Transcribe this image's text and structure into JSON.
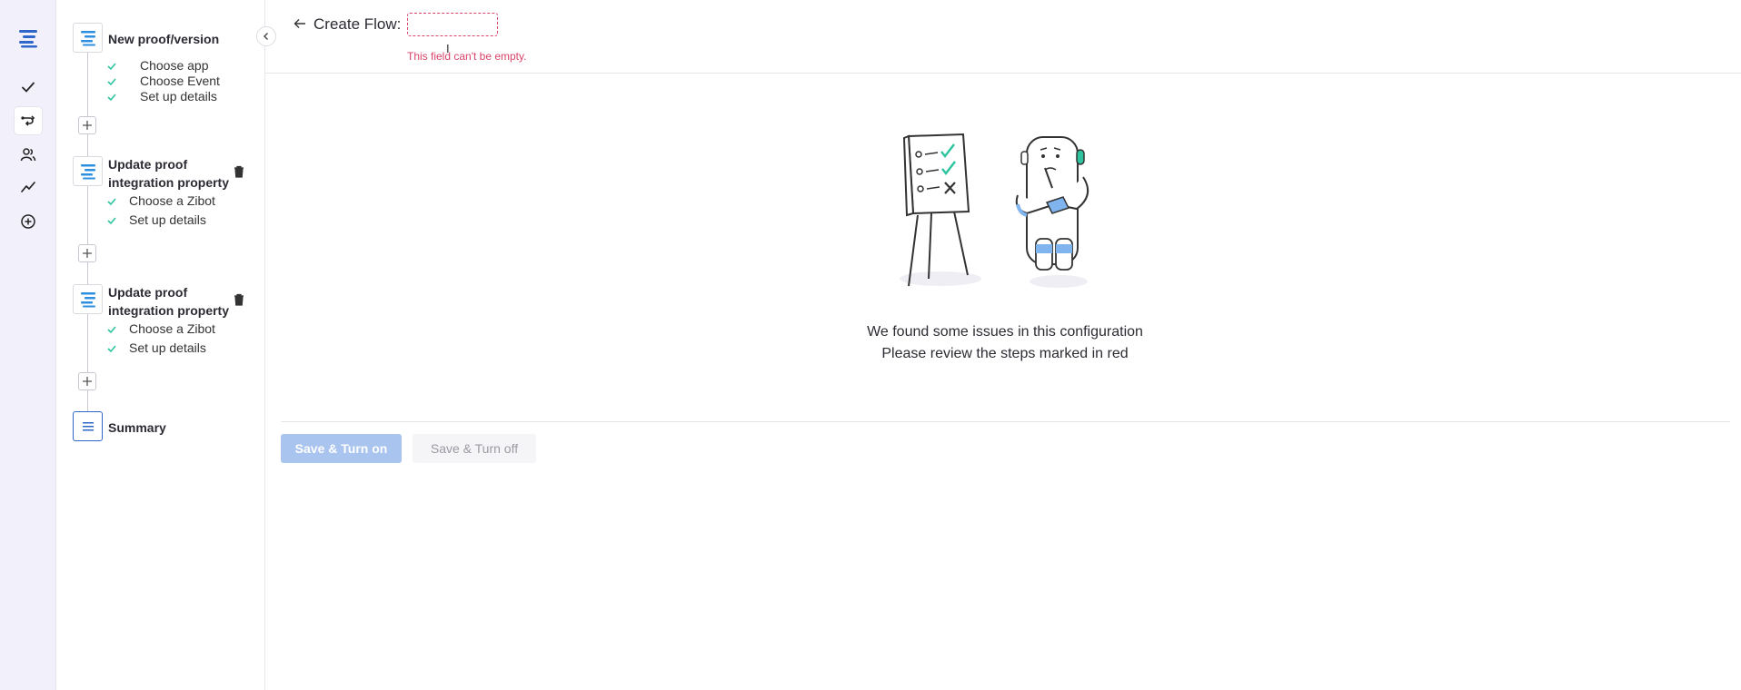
{
  "rail": {
    "icons": [
      "logo-icon",
      "check-icon",
      "flow-icon",
      "users-icon",
      "chart-icon",
      "plus-circle-icon"
    ],
    "active": "flow-icon"
  },
  "header": {
    "title": "Create Flow:",
    "name_value": "",
    "error": "This field can't be empty."
  },
  "steps": [
    {
      "title": "New proof/version",
      "subs": [
        "Choose app",
        "Choose Event",
        "Set up details"
      ]
    },
    {
      "title_line1": "Update proof",
      "title_line2": "integration property",
      "subs": [
        "Choose a Zibot",
        "Set up details"
      ]
    },
    {
      "title_line1": "Update proof",
      "title_line2": "integration property",
      "subs": [
        "Choose a Zibot",
        "Set up details"
      ]
    }
  ],
  "summary": {
    "title": "Summary"
  },
  "message": {
    "line1": "We found some issues in this configuration",
    "line2": "Please review the steps marked in red"
  },
  "buttons": {
    "save_on": "Save & Turn on",
    "save_off": "Save & Turn off"
  },
  "colors": {
    "accent": "#2d67c9",
    "error": "#d9436a",
    "check": "#2fc4a0",
    "disabled_primary": "#a9c4ee"
  }
}
